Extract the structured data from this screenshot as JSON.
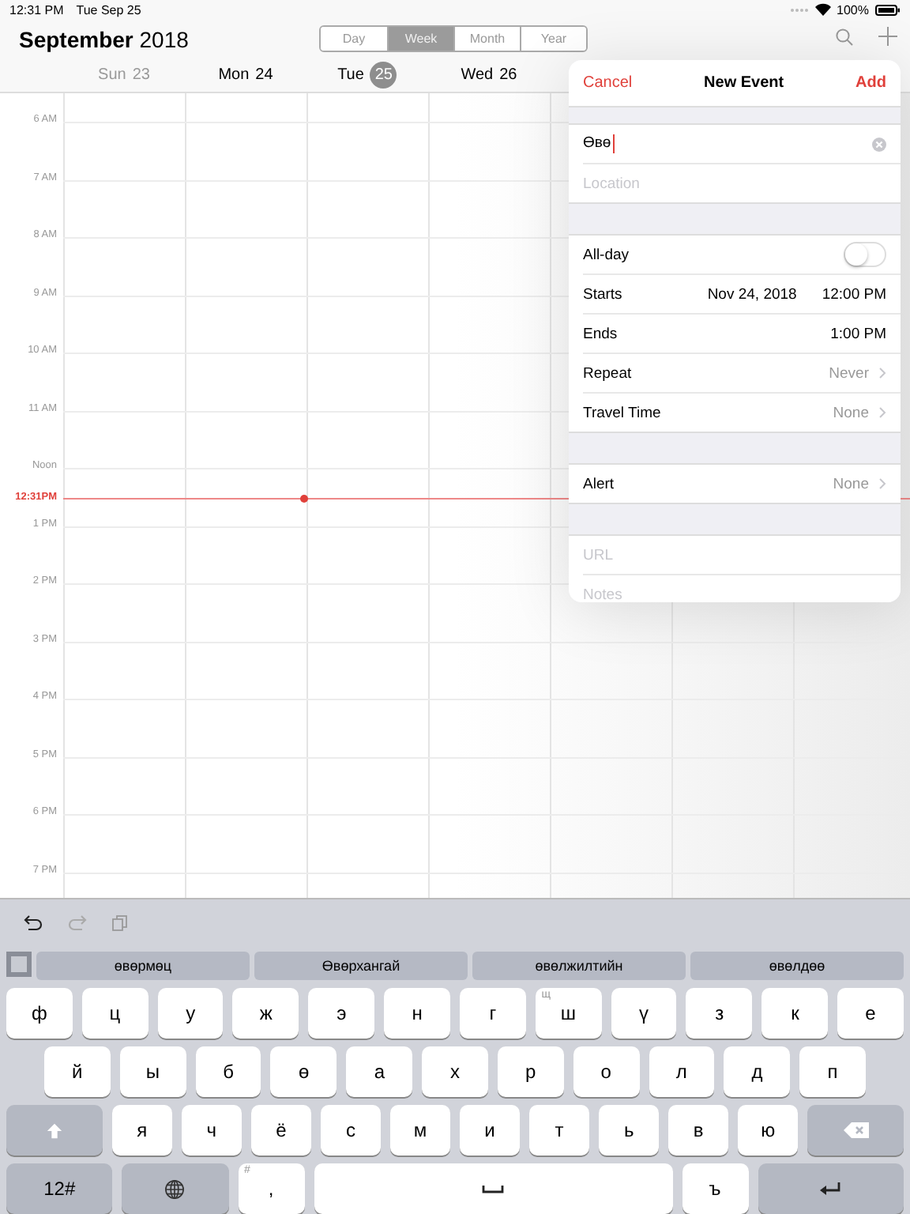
{
  "status_bar": {
    "time": "12:31 PM",
    "date": "Tue Sep 25",
    "battery": "100%"
  },
  "header": {
    "title": "**September** 2018",
    "views": [
      {
        "label": "Day",
        "selected": false
      },
      {
        "label": "Week",
        "selected": true
      },
      {
        "label": "Month",
        "selected": false
      },
      {
        "label": "Year",
        "selected": false
      }
    ]
  },
  "days": [
    {
      "label": "Sun",
      "number": "23",
      "today": false,
      "weekend": true
    },
    {
      "label": "Mon",
      "number": "24",
      "today": false,
      "weekend": false
    },
    {
      "label": "Tue",
      "number": "25",
      "today": true,
      "weekend": false
    },
    {
      "label": "Wed",
      "number": "26",
      "today": false,
      "weekend": false
    }
  ],
  "hours": [
    {
      "kind": "hour",
      "label": "6 AM"
    },
    {
      "kind": "hour",
      "label": "7 AM"
    },
    {
      "kind": "hour",
      "label": "8 AM"
    },
    {
      "kind": "hour",
      "label": "9 AM"
    },
    {
      "kind": "hour",
      "label": "10 AM"
    },
    {
      "kind": "hour",
      "label": "11 AM"
    },
    {
      "kind": "hour",
      "label": "Noon"
    },
    {
      "kind": "now",
      "label": "12:31PM"
    },
    {
      "kind": "hour",
      "label": "1 PM"
    },
    {
      "kind": "hour",
      "label": "2 PM"
    },
    {
      "kind": "hour",
      "label": "3 PM"
    },
    {
      "kind": "hour",
      "label": "4 PM"
    },
    {
      "kind": "hour",
      "label": "5 PM"
    },
    {
      "kind": "hour",
      "label": "6 PM"
    },
    {
      "kind": "hour",
      "label": "7 PM"
    }
  ],
  "new_event": {
    "cancel": "Cancel",
    "title": "New Event",
    "add": "Add",
    "sections": [
      [
        {
          "kind": "input",
          "value": "Өвө"
        },
        {
          "kind": "input",
          "placeholder": "Location"
        }
      ],
      [
        {
          "kind": "toggle",
          "label": "All-day",
          "on": false
        },
        {
          "kind": "datetime",
          "label": "Starts",
          "date": "Nov 24, 2018",
          "time": "12:00 PM"
        },
        {
          "kind": "datetime",
          "label": "Ends",
          "time": "1:00 PM"
        },
        {
          "kind": "choice",
          "label": "Repeat",
          "value": "Never"
        },
        {
          "kind": "choice",
          "label": "Travel Time",
          "value": "None"
        }
      ],
      [
        {
          "kind": "choice",
          "label": "Alert",
          "value": "None"
        }
      ],
      [
        {
          "kind": "input",
          "placeholder": "URL"
        },
        {
          "kind": "input",
          "placeholder": "Notes"
        }
      ]
    ]
  },
  "keyboard": {
    "suggestions": [
      "өвөрмөц",
      "Өвөрхангай",
      "өвөлжилтийн",
      "өвөлдөө"
    ],
    "rows": [
      [
        {
          "kind": "letter",
          "label": "ф"
        },
        {
          "kind": "letter",
          "label": "ц"
        },
        {
          "kind": "letter",
          "label": "у"
        },
        {
          "kind": "letter",
          "label": "ж"
        },
        {
          "kind": "letter",
          "label": "э"
        },
        {
          "kind": "letter",
          "label": "н"
        },
        {
          "kind": "letter",
          "label": "г"
        },
        {
          "kind": "letter",
          "label": "ш",
          "hint": "щ"
        },
        {
          "kind": "letter",
          "label": "ү"
        },
        {
          "kind": "letter",
          "label": "з"
        },
        {
          "kind": "letter",
          "label": "к"
        },
        {
          "kind": "letter",
          "label": "е"
        }
      ],
      [
        {
          "kind": "letter",
          "label": "й"
        },
        {
          "kind": "letter",
          "label": "ы"
        },
        {
          "kind": "letter",
          "label": "б"
        },
        {
          "kind": "letter",
          "label": "ө"
        },
        {
          "kind": "letter",
          "label": "а"
        },
        {
          "kind": "letter",
          "label": "х"
        },
        {
          "kind": "letter",
          "label": "р"
        },
        {
          "kind": "letter",
          "label": "о"
        },
        {
          "kind": "letter",
          "label": "л"
        },
        {
          "kind": "letter",
          "label": "д"
        },
        {
          "kind": "letter",
          "label": "п"
        }
      ],
      [
        {
          "kind": "shift"
        },
        {
          "kind": "letter",
          "label": "я"
        },
        {
          "kind": "letter",
          "label": "ч"
        },
        {
          "kind": "letter",
          "label": "ё"
        },
        {
          "kind": "letter",
          "label": "с"
        },
        {
          "kind": "letter",
          "label": "м"
        },
        {
          "kind": "letter",
          "label": "и"
        },
        {
          "kind": "letter",
          "label": "т"
        },
        {
          "kind": "letter",
          "label": "ь"
        },
        {
          "kind": "letter",
          "label": "в"
        },
        {
          "kind": "letter",
          "label": "ю"
        },
        {
          "kind": "delete"
        }
      ],
      [
        {
          "kind": "numbers",
          "label": "12#"
        },
        {
          "kind": "globe"
        },
        {
          "kind": "letter",
          "label": ",",
          "hint": "#"
        },
        {
          "kind": "space"
        },
        {
          "kind": "letter",
          "label": "ъ"
        },
        {
          "kind": "return"
        }
      ]
    ]
  }
}
